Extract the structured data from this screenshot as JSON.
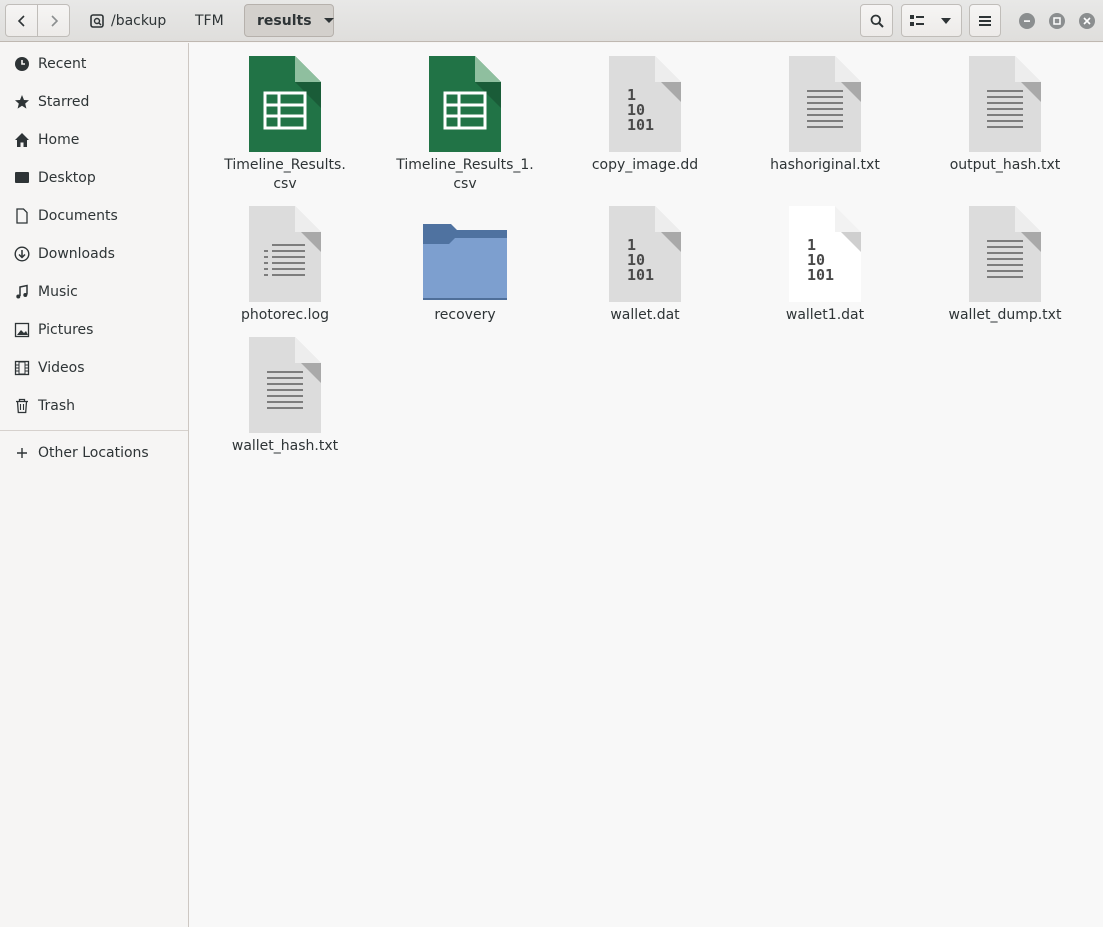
{
  "window": {
    "breadcrumb": [
      {
        "label": "/backup"
      },
      {
        "label": "TFM"
      },
      {
        "label": "results"
      }
    ]
  },
  "toolbar": {
    "back_icon": "chevron-left-icon",
    "forward_icon": "chevron-right-icon",
    "search_icon": "search-icon",
    "view_icon": "list-view-icon",
    "menu_icon": "hamburger-menu-icon"
  },
  "sidebar": {
    "items": [
      {
        "label": "Recent",
        "icon": "clock-icon"
      },
      {
        "label": "Starred",
        "icon": "star-icon"
      },
      {
        "label": "Home",
        "icon": "home-icon"
      },
      {
        "label": "Desktop",
        "icon": "desktop-icon"
      },
      {
        "label": "Documents",
        "icon": "document-icon"
      },
      {
        "label": "Downloads",
        "icon": "download-icon"
      },
      {
        "label": "Music",
        "icon": "music-icon"
      },
      {
        "label": "Pictures",
        "icon": "picture-icon"
      },
      {
        "label": "Videos",
        "icon": "video-icon"
      },
      {
        "label": "Trash",
        "icon": "trash-icon"
      }
    ],
    "other_locations": {
      "label": "Other Locations",
      "icon": "plus-icon"
    }
  },
  "files": [
    {
      "name": "Timeline_Results.\ncsv",
      "type": "spreadsheet"
    },
    {
      "name": "Timeline_Results_1.\ncsv",
      "type": "spreadsheet"
    },
    {
      "name": "copy_image.dd",
      "type": "binary"
    },
    {
      "name": "hashoriginal.txt",
      "type": "text"
    },
    {
      "name": "output_hash.txt",
      "type": "text"
    },
    {
      "name": "photorec.log",
      "type": "log"
    },
    {
      "name": "recovery",
      "type": "folder"
    },
    {
      "name": "wallet.dat",
      "type": "binary"
    },
    {
      "name": "wallet1.dat",
      "type": "binary-white"
    },
    {
      "name": "wallet_dump.txt",
      "type": "text"
    },
    {
      "name": "wallet_hash.txt",
      "type": "text"
    }
  ],
  "colors": {
    "spreadsheet": "#217346",
    "folder": "#7a9fd0",
    "file_gray": "#dcdcdc"
  }
}
